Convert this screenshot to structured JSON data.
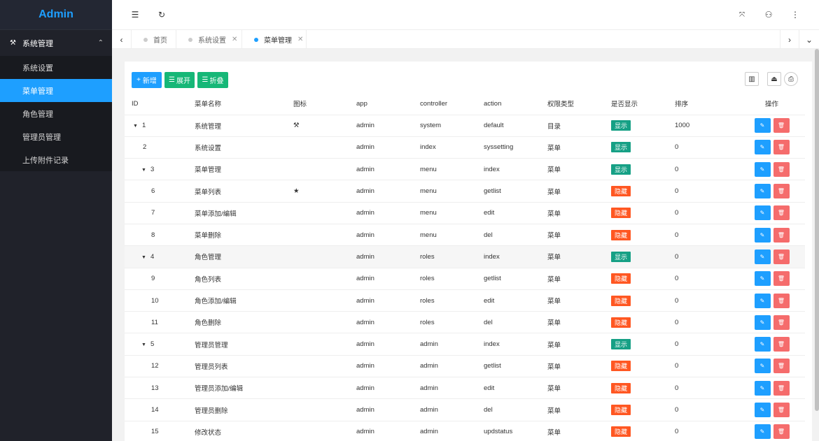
{
  "app": {
    "title": "Admin"
  },
  "sidebar": {
    "group": {
      "label": "系统管理",
      "icon": "tools-icon"
    },
    "items": [
      {
        "label": "系统设置",
        "active": false
      },
      {
        "label": "菜单管理",
        "active": true
      },
      {
        "label": "角色管理",
        "active": false
      },
      {
        "label": "管理员管理",
        "active": false
      },
      {
        "label": "上传附件记录",
        "active": false
      }
    ]
  },
  "tabs": [
    {
      "label": "首页",
      "active": false,
      "closable": false
    },
    {
      "label": "系统设置",
      "active": false,
      "closable": true
    },
    {
      "label": "菜单管理",
      "active": true,
      "closable": true
    }
  ],
  "toolbar": {
    "add_label": "新增",
    "expand_label": "展开",
    "collapse_label": "折叠"
  },
  "table": {
    "columns": [
      "ID",
      "菜单名称",
      "图标",
      "app",
      "controller",
      "action",
      "权限类型",
      "是否显示",
      "排序",
      "操作"
    ],
    "rows": [
      {
        "id": "1",
        "name": "系统管理",
        "icon": "⚒",
        "app": "admin",
        "controller": "system",
        "action": "default",
        "type": "目录",
        "show": "显示",
        "sort": "1000",
        "level": 0,
        "caret": true
      },
      {
        "id": "2",
        "name": "系统设置",
        "icon": "",
        "app": "admin",
        "controller": "index",
        "action": "syssetting",
        "type": "菜单",
        "show": "显示",
        "sort": "0",
        "level": 1,
        "caret": false
      },
      {
        "id": "3",
        "name": "菜单管理",
        "icon": "",
        "app": "admin",
        "controller": "menu",
        "action": "index",
        "type": "菜单",
        "show": "显示",
        "sort": "0",
        "level": 1,
        "caret": true
      },
      {
        "id": "6",
        "name": "菜单列表",
        "icon": "★",
        "app": "admin",
        "controller": "menu",
        "action": "getlist",
        "type": "菜单",
        "show": "隐藏",
        "sort": "0",
        "level": 2,
        "caret": false
      },
      {
        "id": "7",
        "name": "菜单添加/编辑",
        "icon": "",
        "app": "admin",
        "controller": "menu",
        "action": "edit",
        "type": "菜单",
        "show": "隐藏",
        "sort": "0",
        "level": 2,
        "caret": false
      },
      {
        "id": "8",
        "name": "菜单删除",
        "icon": "",
        "app": "admin",
        "controller": "menu",
        "action": "del",
        "type": "菜单",
        "show": "隐藏",
        "sort": "0",
        "level": 2,
        "caret": false
      },
      {
        "id": "4",
        "name": "角色管理",
        "icon": "",
        "app": "admin",
        "controller": "roles",
        "action": "index",
        "type": "菜单",
        "show": "显示",
        "sort": "0",
        "level": 1,
        "caret": true,
        "highlight": true
      },
      {
        "id": "9",
        "name": "角色列表",
        "icon": "",
        "app": "admin",
        "controller": "roles",
        "action": "getlist",
        "type": "菜单",
        "show": "隐藏",
        "sort": "0",
        "level": 2,
        "caret": false
      },
      {
        "id": "10",
        "name": "角色添加/编辑",
        "icon": "",
        "app": "admin",
        "controller": "roles",
        "action": "edit",
        "type": "菜单",
        "show": "隐藏",
        "sort": "0",
        "level": 2,
        "caret": false
      },
      {
        "id": "11",
        "name": "角色删除",
        "icon": "",
        "app": "admin",
        "controller": "roles",
        "action": "del",
        "type": "菜单",
        "show": "隐藏",
        "sort": "0",
        "level": 2,
        "caret": false
      },
      {
        "id": "5",
        "name": "管理员管理",
        "icon": "",
        "app": "admin",
        "controller": "admin",
        "action": "index",
        "type": "菜单",
        "show": "显示",
        "sort": "0",
        "level": 1,
        "caret": true
      },
      {
        "id": "12",
        "name": "管理员列表",
        "icon": "",
        "app": "admin",
        "controller": "admin",
        "action": "getlist",
        "type": "菜单",
        "show": "隐藏",
        "sort": "0",
        "level": 2,
        "caret": false
      },
      {
        "id": "13",
        "name": "管理员添加/编辑",
        "icon": "",
        "app": "admin",
        "controller": "admin",
        "action": "edit",
        "type": "菜单",
        "show": "隐藏",
        "sort": "0",
        "level": 2,
        "caret": false
      },
      {
        "id": "14",
        "name": "管理员删除",
        "icon": "",
        "app": "admin",
        "controller": "admin",
        "action": "del",
        "type": "菜单",
        "show": "隐藏",
        "sort": "0",
        "level": 2,
        "caret": false
      },
      {
        "id": "15",
        "name": "修改状态",
        "icon": "",
        "app": "admin",
        "controller": "admin",
        "action": "updstatus",
        "type": "菜单",
        "show": "隐藏",
        "sort": "0",
        "level": 2,
        "caret": false
      }
    ]
  },
  "colors": {
    "accent": "#1e9fff",
    "green": "#16b777",
    "show": "#16a085",
    "hide": "#ff5722",
    "danger": "#f56c6c",
    "sidebar": "#20222a"
  }
}
